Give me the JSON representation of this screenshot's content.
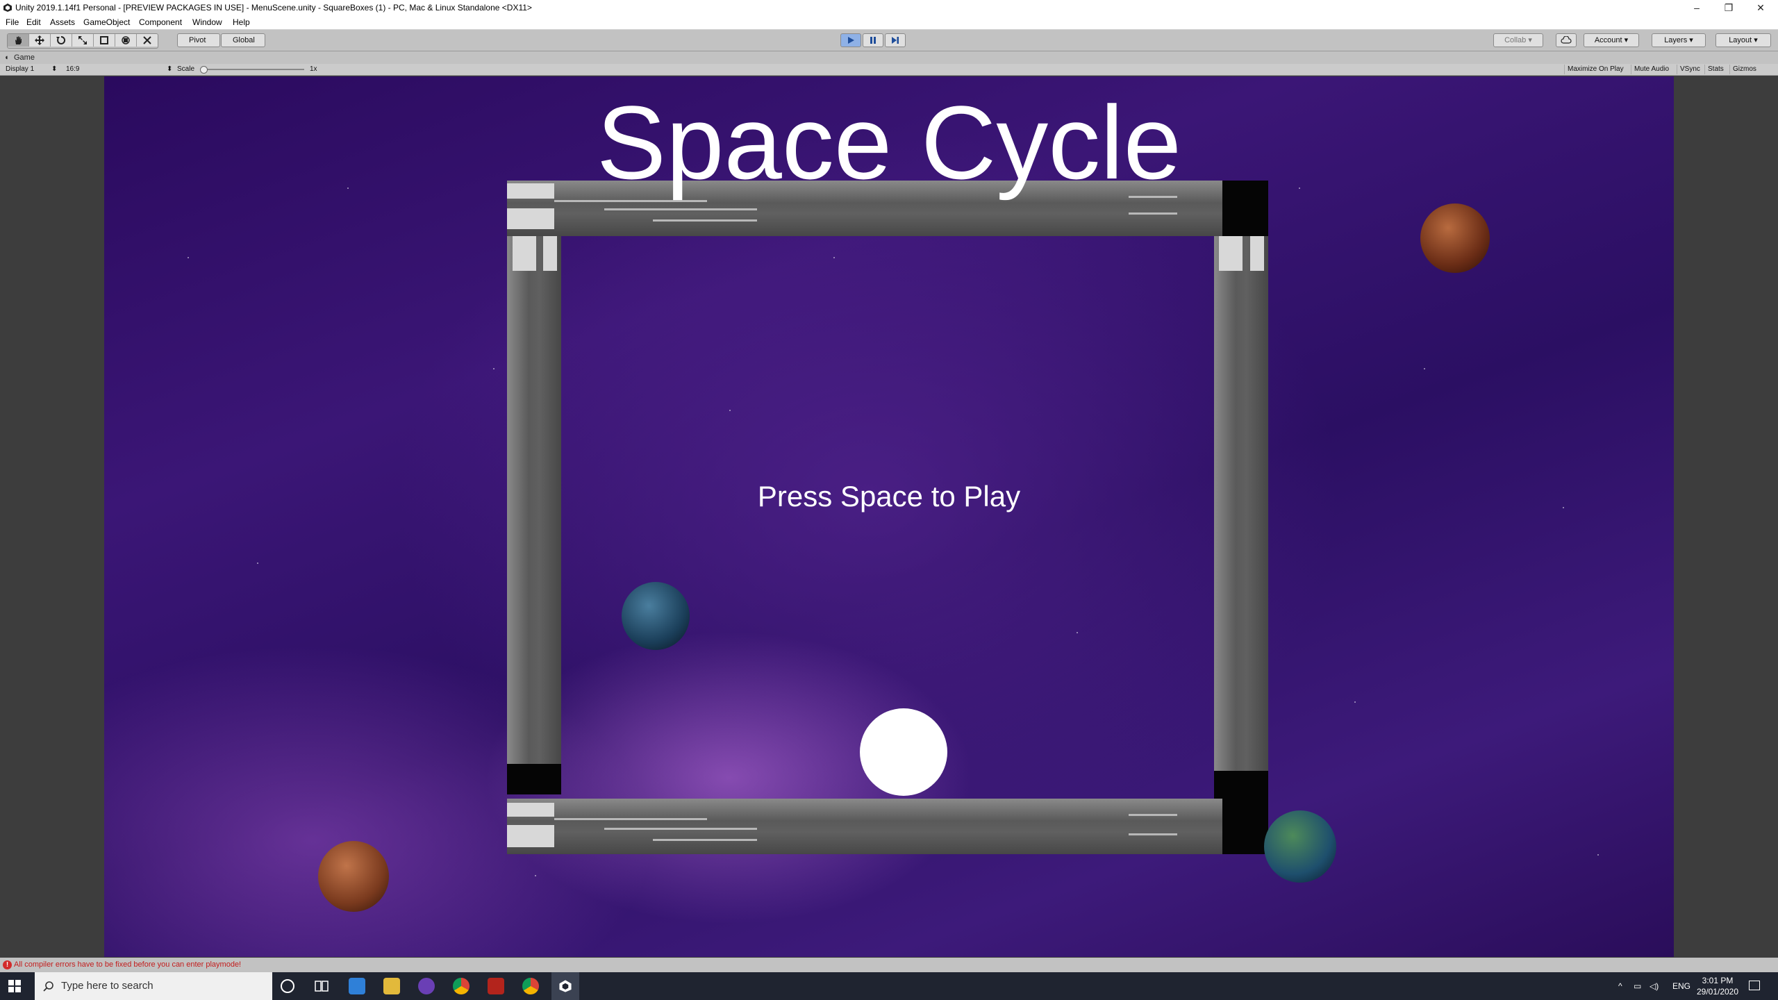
{
  "window": {
    "title": "Unity 2019.1.14f1 Personal - [PREVIEW PACKAGES IN USE] - MenuScene.unity - SquareBoxes (1) - PC, Mac & Linux Standalone <DX11>",
    "minimize": "–",
    "restore": "❐",
    "close": "✕"
  },
  "menu": {
    "items": [
      "File",
      "Edit",
      "Assets",
      "GameObject",
      "Component",
      "Window",
      "Help"
    ]
  },
  "toolbar": {
    "pivot_label": "Pivot",
    "global_label": "Global",
    "collab_label": "Collab",
    "account_label": "Account",
    "layers_label": "Layers",
    "layout_label": "Layout"
  },
  "game_tab": {
    "label": "Game",
    "display": "Display 1",
    "aspect": "16:9",
    "scale_label": "Scale",
    "scale_value": "1x",
    "maximize_on_play": "Maximize On Play",
    "mute_audio": "Mute Audio",
    "vsync": "VSync",
    "stats": "Stats",
    "gizmos": "Gizmos"
  },
  "game": {
    "title": "Space Cycle",
    "prompt": "Press Space to Play"
  },
  "status": {
    "error": "All compiler errors have to be fixed before you can enter playmode!"
  },
  "taskbar": {
    "search_placeholder": "Type here to search",
    "tray_lang": "ENG",
    "time": "3:01 PM",
    "date": "29/01/2020"
  },
  "colors": {
    "play_active": "#8fb1e6",
    "error_text": "#c21d1d",
    "taskbar_bg": "#1f2430"
  }
}
